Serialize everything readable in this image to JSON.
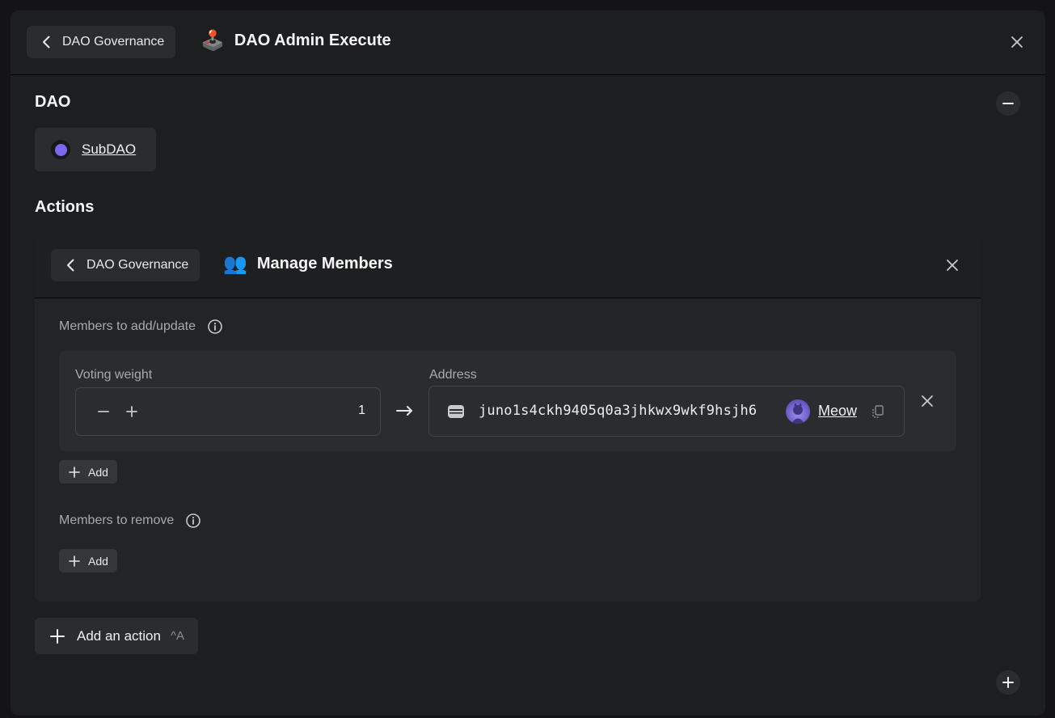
{
  "header": {
    "back_label": "DAO Governance",
    "title": "DAO Admin Execute",
    "title_emoji": "🕹️"
  },
  "dao_section": {
    "title": "DAO",
    "selected_dao": "SubDAO",
    "dao_color": "#7c68ee"
  },
  "actions_section": {
    "title": "Actions",
    "action": {
      "back_label": "DAO Governance",
      "title": "Manage Members",
      "title_emoji": "👥",
      "to_add": {
        "label": "Members to add/update",
        "members": [
          {
            "voting_weight_label": "Voting weight",
            "voting_weight": "1",
            "address_label": "Address",
            "address": "juno1s4ckh9405q0a3jhkwx9wkf9hsjh6",
            "profile_name": "Meow"
          }
        ],
        "add_label": "Add"
      },
      "to_remove": {
        "label": "Members to remove",
        "add_label": "Add"
      }
    },
    "add_action_label": "Add an action",
    "add_action_shortcut": "^A"
  },
  "colors": {
    "accent": "#7c68ee",
    "panel_bg": "#1d1e20",
    "card_bg": "#2b2c2f"
  }
}
